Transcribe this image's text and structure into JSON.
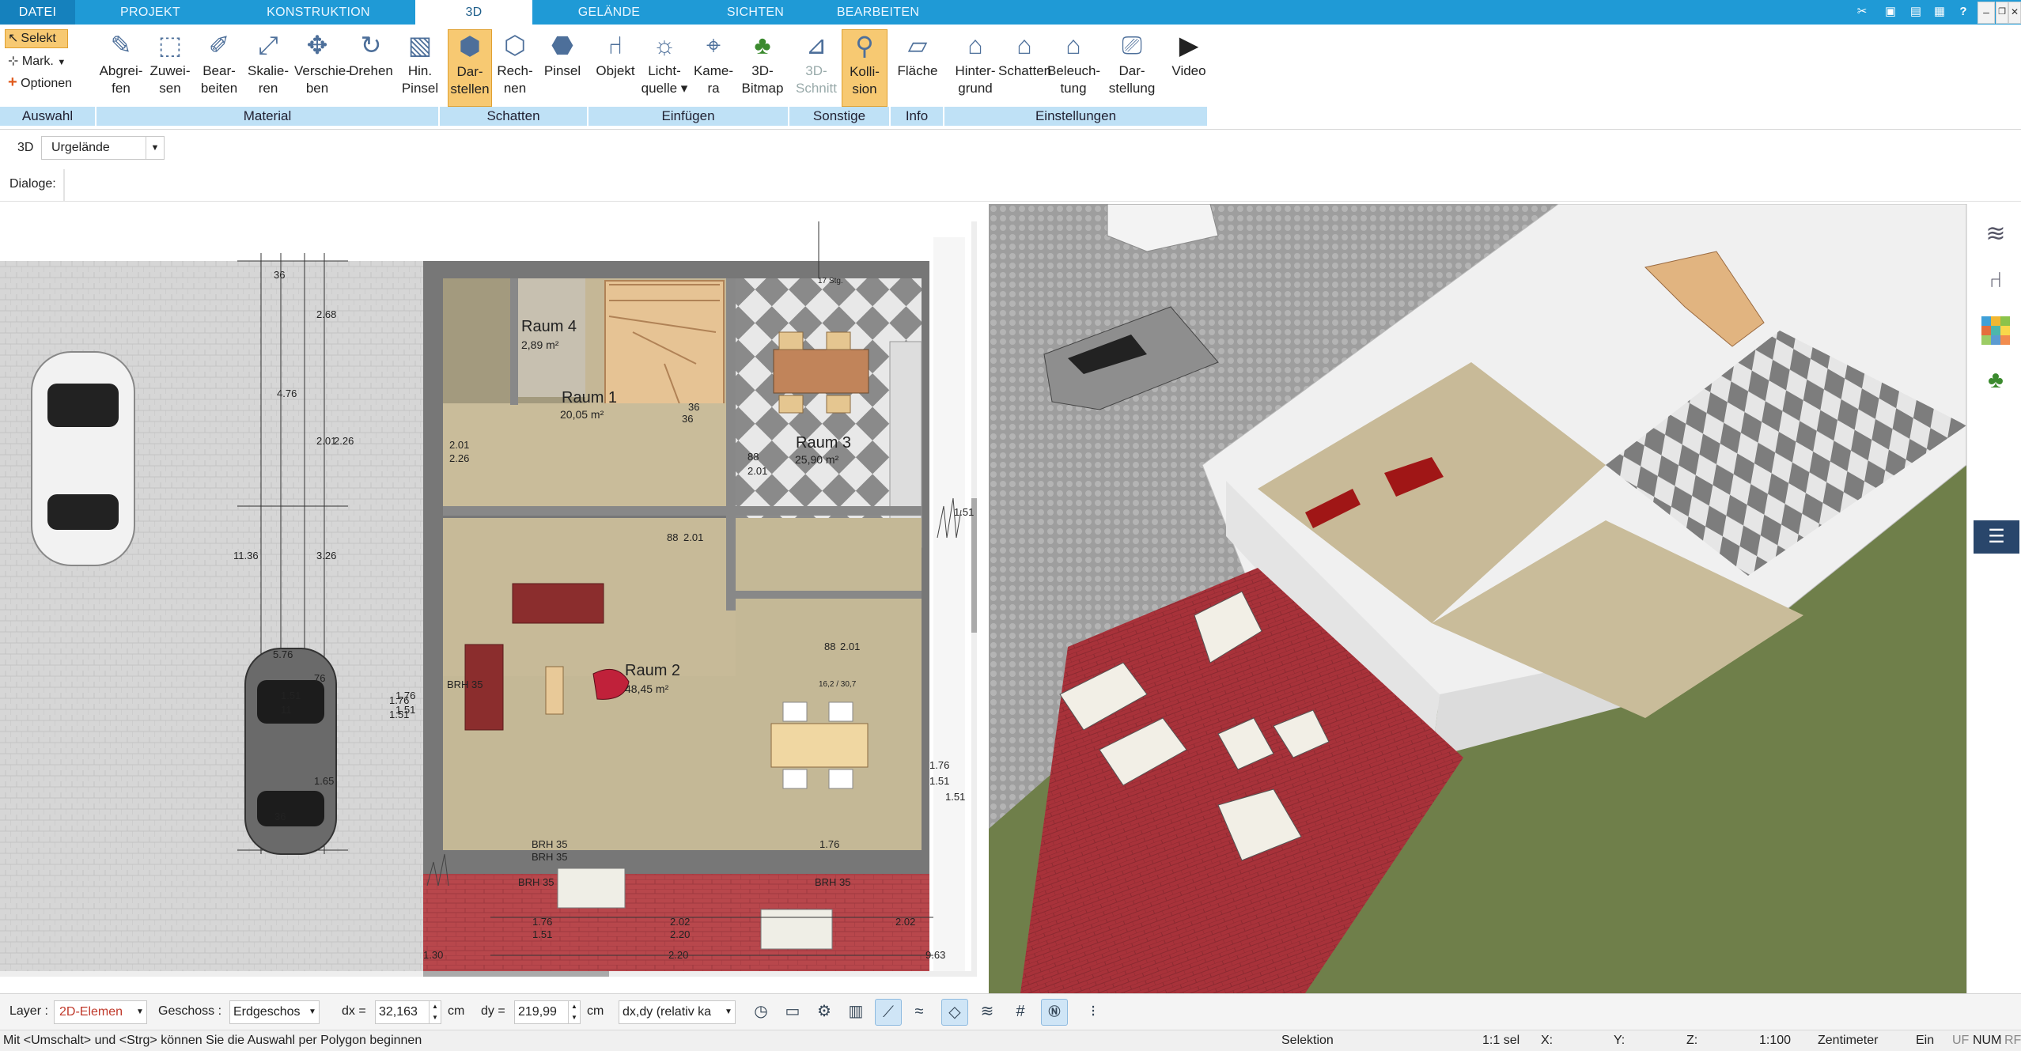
{
  "tabs": [
    {
      "label": "DATEI",
      "active": false
    },
    {
      "label": "PROJEKT",
      "active": false
    },
    {
      "label": "KONSTRUKTION",
      "active": false
    },
    {
      "label": "3D",
      "active": true
    },
    {
      "label": "GELÄNDE",
      "active": false
    },
    {
      "label": "SICHTEN",
      "active": false
    },
    {
      "label": "BEARBEITEN",
      "active": false
    }
  ],
  "window": {
    "minimize": "–",
    "restore": "❐",
    "close": "✕"
  },
  "ribbon": {
    "auswahl": {
      "selekt": "Selekt",
      "mark": "Mark.",
      "optionen": "Optionen",
      "group": "Auswahl"
    },
    "material": {
      "group": "Material",
      "buttons": [
        {
          "label1": "Abgrei-",
          "label2": "fen",
          "icon": "eyedropper-icon"
        },
        {
          "label1": "Zuwei-",
          "label2": "sen",
          "icon": "assign-material-icon"
        },
        {
          "label1": "Bear-",
          "label2": "beiten",
          "icon": "edit-material-icon"
        },
        {
          "label1": "Skalie-",
          "label2": "ren",
          "icon": "scale-icon"
        },
        {
          "label1": "Verschie-",
          "label2": "ben",
          "icon": "move-icon"
        },
        {
          "label1": "Drehen",
          "label2": "",
          "icon": "rotate-icon"
        },
        {
          "label1": "Hin.",
          "label2": "Pinsel",
          "icon": "brush-icon"
        }
      ]
    },
    "schatten": {
      "group": "Schatten",
      "buttons": [
        {
          "label1": "Dar-",
          "label2": "stellen",
          "icon": "shadow-display-icon",
          "active": true
        },
        {
          "label1": "Rech-",
          "label2": "nen",
          "icon": "shadow-calc-icon"
        },
        {
          "label1": "Pinsel",
          "label2": "",
          "icon": "shadow-brush-icon"
        }
      ]
    },
    "einfuegen": {
      "group": "Einfügen",
      "buttons": [
        {
          "label1": "Objekt",
          "label2": "",
          "icon": "chair-icon"
        },
        {
          "label1": "Licht-",
          "label2": "quelle ▾",
          "icon": "lightbulb-icon"
        },
        {
          "label1": "Kame-",
          "label2": "ra",
          "icon": "camera-icon"
        },
        {
          "label1": "3D-",
          "label2": "Bitmap",
          "icon": "tree-icon"
        }
      ]
    },
    "sonstige": {
      "group": "Sonstige",
      "buttons": [
        {
          "label1": "3D-",
          "label2": "Schnitt",
          "icon": "section-icon",
          "disabled": true
        },
        {
          "label1": "Kolli-",
          "label2": "sion",
          "icon": "collision-icon",
          "active": true
        }
      ]
    },
    "info": {
      "group": "Info",
      "buttons": [
        {
          "label1": "Fläche",
          "label2": "",
          "icon": "area-icon"
        }
      ]
    },
    "einstellungen": {
      "group": "Einstellungen",
      "buttons": [
        {
          "label1": "Hinter-",
          "label2": "grund",
          "icon": "background-icon"
        },
        {
          "label1": "Schatten",
          "label2": "",
          "icon": "shadow-settings-icon"
        },
        {
          "label1": "Beleuch-",
          "label2": "tung",
          "icon": "lighting-icon"
        },
        {
          "label1": "Dar-",
          "label2": "stellung",
          "icon": "display-settings-icon"
        },
        {
          "label1": "Video",
          "label2": "",
          "icon": "video-icon"
        }
      ]
    }
  },
  "toolbar": {
    "mode_label": "3D",
    "terrain_value": "Urgelände",
    "dialoge_label": "Dialoge:"
  },
  "plan": {
    "rooms": [
      {
        "name": "Raum 4",
        "area": "2,89 m²"
      },
      {
        "name": "Raum 1",
        "area": "20,05 m²"
      },
      {
        "name": "Raum 3",
        "area": "25,90 m²"
      },
      {
        "name": "Raum 2",
        "area": "48,45 m²"
      }
    ],
    "dims": [
      "36",
      "2.68",
      "4.76",
      "2.01",
      "2.26",
      "11.36",
      "1.76",
      "1.51",
      "3.26",
      "5.76",
      "76",
      "1.65",
      "36",
      "1.76",
      "1.51",
      "BRH 35",
      "BRH 35",
      "BRH 35",
      "2.01",
      "2.26",
      "88",
      "2.01",
      "88",
      "2.01",
      "88",
      "2.01",
      "2.02",
      "2.20",
      "1.76",
      "1.51",
      "2.02",
      "2.20",
      "1.30",
      "9.63",
      "36",
      "36",
      "17 Stg.",
      "16,2 / 30,7",
      "BRH 35",
      "BRH 35",
      "1.76",
      "1.51",
      "1.51",
      "11",
      "1.76",
      "1.51",
      "1.51"
    ]
  },
  "bottom": {
    "layer_label": "Layer :",
    "layer_value": "2D-Elemen",
    "geschoss_label": "Geschoss :",
    "geschoss_value": "Erdgeschos",
    "dx_label": "dx =",
    "dx_value": "32,163",
    "dx_unit": "cm",
    "dy_label": "dy =",
    "dy_value": "219,99",
    "dy_unit": "cm",
    "rel_value": "dx,dy (relativ ka"
  },
  "status": {
    "hint": "Mit <Umschalt> und <Strg> können Sie die Auswahl per Polygon beginnen",
    "mode": "Selektion",
    "sel": "1:1 sel",
    "x": "X:",
    "y": "Y:",
    "z": "Z:",
    "scale": "1:100",
    "unit": "Zentimeter",
    "ein": "Ein",
    "uf": "UF",
    "num": "NUM",
    "rf": "RF"
  }
}
